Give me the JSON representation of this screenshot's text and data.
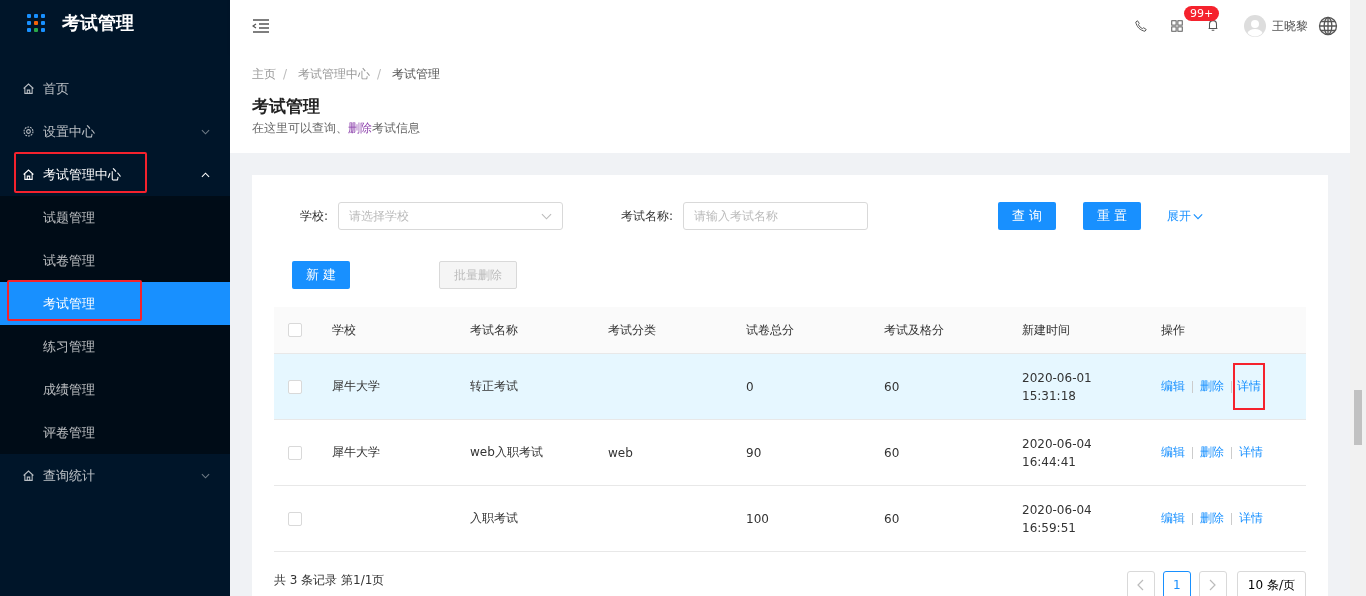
{
  "app": {
    "title": "考试管理"
  },
  "sidebar": {
    "items": [
      {
        "label": "首页",
        "kind": "home",
        "highlighted": false
      },
      {
        "label": "设置中心",
        "kind": "gear",
        "expanded": false,
        "highlighted": false
      },
      {
        "label": "考试管理中心",
        "kind": "home",
        "expanded": true,
        "highlighted": true,
        "children": [
          {
            "label": "试题管理",
            "selected": false,
            "highlighted": false
          },
          {
            "label": "试卷管理",
            "selected": false,
            "highlighted": false
          },
          {
            "label": "考试管理",
            "selected": true,
            "highlighted": true
          },
          {
            "label": "练习管理",
            "selected": false,
            "highlighted": false
          },
          {
            "label": "成绩管理",
            "selected": false,
            "highlighted": false
          },
          {
            "label": "评卷管理",
            "selected": false,
            "highlighted": false
          }
        ]
      },
      {
        "label": "查询统计",
        "kind": "home",
        "expanded": false,
        "highlighted": false
      }
    ]
  },
  "header": {
    "notification_badge": "99+",
    "user_name": "王晓黎"
  },
  "breadcrumb": [
    {
      "label": "主页",
      "current": false
    },
    {
      "separator": "/",
      "label": "考试管理中心",
      "current": false
    },
    {
      "separator": "/",
      "label": "考试管理",
      "current": true
    }
  ],
  "page": {
    "title": "考试管理",
    "subtitle": [
      {
        "text": "在这里可以查询、",
        "accent": false
      },
      {
        "text": "删除",
        "accent": true
      },
      {
        "text": "考试信息",
        "accent": false
      }
    ]
  },
  "filters": [
    {
      "label": "学校:",
      "kind": "select",
      "placeholder": "请选择学校"
    },
    {
      "label": "考试名称:",
      "kind": "input",
      "placeholder": "请输入考试名称"
    }
  ],
  "filter_buttons": [
    "查 询",
    "重 置"
  ],
  "expand_link": "展开",
  "actions": [
    {
      "label": "新 建",
      "disabled": false
    },
    {
      "label": "批量删除",
      "disabled": true
    }
  ],
  "table": {
    "header_checked": false,
    "columns": [
      "学校",
      "考试名称",
      "考试分类",
      "试卷总分",
      "考试及格分",
      "新建时间",
      "操作"
    ],
    "rows": [
      {
        "checked": false,
        "hovered": true,
        "cells": [
          "犀牛大学",
          "转正考试",
          "",
          "0",
          "60"
        ],
        "date": "2020-06-01",
        "time": "15:31:18",
        "ops": [
          {
            "label": "编辑",
            "highlighted": false
          },
          {
            "label": "删除",
            "highlighted": false
          },
          {
            "label": "详情",
            "highlighted": true
          }
        ]
      },
      {
        "checked": false,
        "hovered": false,
        "cells": [
          "犀牛大学",
          "web入职考试",
          "web",
          "90",
          "60"
        ],
        "date": "2020-06-04",
        "time": "16:44:41",
        "ops": [
          {
            "label": "编辑",
            "highlighted": false
          },
          {
            "label": "删除",
            "highlighted": false
          },
          {
            "label": "详情",
            "highlighted": false
          }
        ]
      },
      {
        "checked": false,
        "hovered": false,
        "cells": [
          "",
          "入职考试",
          "",
          "100",
          "60"
        ],
        "date": "2020-06-04",
        "time": "16:59:51",
        "ops": [
          {
            "label": "编辑",
            "highlighted": false
          },
          {
            "label": "删除",
            "highlighted": false
          },
          {
            "label": "详情",
            "highlighted": false
          }
        ]
      }
    ]
  },
  "footer": {
    "summary": "共 3 条记录 第1/1页",
    "pages": [
      {
        "label": "1",
        "selected": true
      }
    ],
    "page_size": "10 条/页"
  }
}
